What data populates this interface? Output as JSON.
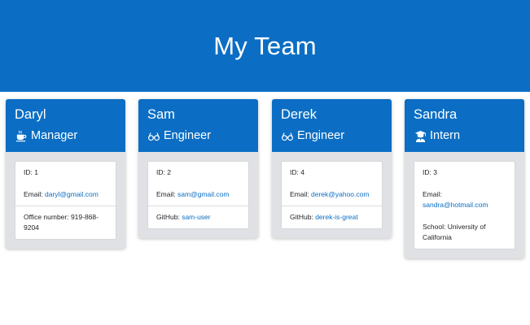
{
  "header": {
    "title": "My Team"
  },
  "labels": {
    "id": "ID: ",
    "email": "Email: ",
    "office": "Office number: ",
    "github": "GitHub: ",
    "school": "School: "
  },
  "cards": [
    {
      "name": "Daryl",
      "role": "Manager",
      "icon": "coffee-icon",
      "id": "1",
      "email": "daryl@gmail.com",
      "office_number": "919-868-9204"
    },
    {
      "name": "Sam",
      "role": "Engineer",
      "icon": "glasses-icon",
      "id": "2",
      "email": "sam@gmail.com",
      "github": "sam-user"
    },
    {
      "name": "Derek",
      "role": "Engineer",
      "icon": "glasses-icon",
      "id": "4",
      "email": "derek@yahoo.com",
      "github": "derek-is-great"
    },
    {
      "name": "Sandra",
      "role": "Intern",
      "icon": "graduate-icon",
      "id": "3",
      "email": "sandra@hotmail.com",
      "school": "University of California"
    }
  ],
  "colors": {
    "primary": "#0b6ec4",
    "card_bg": "#e0e1e4"
  }
}
